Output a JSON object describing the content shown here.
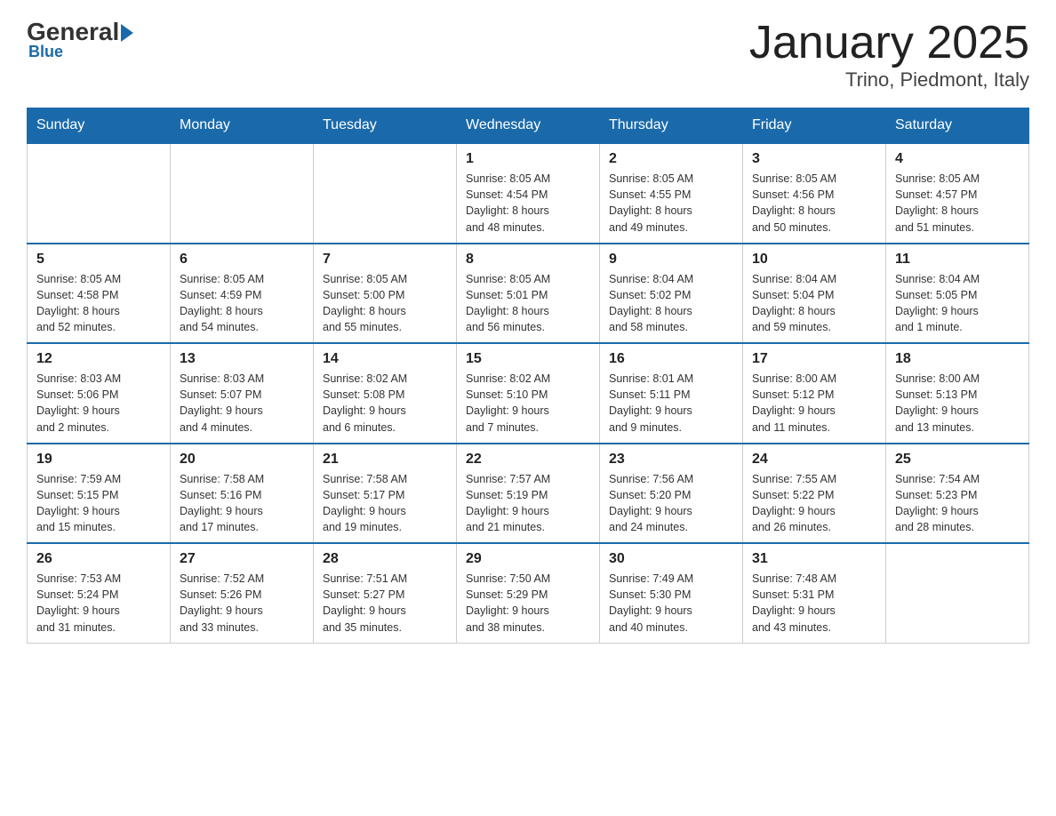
{
  "logo": {
    "general": "General",
    "blue": "Blue",
    "subtitle": "Blue"
  },
  "title": "January 2025",
  "location": "Trino, Piedmont, Italy",
  "days_of_week": [
    "Sunday",
    "Monday",
    "Tuesday",
    "Wednesday",
    "Thursday",
    "Friday",
    "Saturday"
  ],
  "weeks": [
    [
      {
        "day": "",
        "info": ""
      },
      {
        "day": "",
        "info": ""
      },
      {
        "day": "",
        "info": ""
      },
      {
        "day": "1",
        "info": "Sunrise: 8:05 AM\nSunset: 4:54 PM\nDaylight: 8 hours\nand 48 minutes."
      },
      {
        "day": "2",
        "info": "Sunrise: 8:05 AM\nSunset: 4:55 PM\nDaylight: 8 hours\nand 49 minutes."
      },
      {
        "day": "3",
        "info": "Sunrise: 8:05 AM\nSunset: 4:56 PM\nDaylight: 8 hours\nand 50 minutes."
      },
      {
        "day": "4",
        "info": "Sunrise: 8:05 AM\nSunset: 4:57 PM\nDaylight: 8 hours\nand 51 minutes."
      }
    ],
    [
      {
        "day": "5",
        "info": "Sunrise: 8:05 AM\nSunset: 4:58 PM\nDaylight: 8 hours\nand 52 minutes."
      },
      {
        "day": "6",
        "info": "Sunrise: 8:05 AM\nSunset: 4:59 PM\nDaylight: 8 hours\nand 54 minutes."
      },
      {
        "day": "7",
        "info": "Sunrise: 8:05 AM\nSunset: 5:00 PM\nDaylight: 8 hours\nand 55 minutes."
      },
      {
        "day": "8",
        "info": "Sunrise: 8:05 AM\nSunset: 5:01 PM\nDaylight: 8 hours\nand 56 minutes."
      },
      {
        "day": "9",
        "info": "Sunrise: 8:04 AM\nSunset: 5:02 PM\nDaylight: 8 hours\nand 58 minutes."
      },
      {
        "day": "10",
        "info": "Sunrise: 8:04 AM\nSunset: 5:04 PM\nDaylight: 8 hours\nand 59 minutes."
      },
      {
        "day": "11",
        "info": "Sunrise: 8:04 AM\nSunset: 5:05 PM\nDaylight: 9 hours\nand 1 minute."
      }
    ],
    [
      {
        "day": "12",
        "info": "Sunrise: 8:03 AM\nSunset: 5:06 PM\nDaylight: 9 hours\nand 2 minutes."
      },
      {
        "day": "13",
        "info": "Sunrise: 8:03 AM\nSunset: 5:07 PM\nDaylight: 9 hours\nand 4 minutes."
      },
      {
        "day": "14",
        "info": "Sunrise: 8:02 AM\nSunset: 5:08 PM\nDaylight: 9 hours\nand 6 minutes."
      },
      {
        "day": "15",
        "info": "Sunrise: 8:02 AM\nSunset: 5:10 PM\nDaylight: 9 hours\nand 7 minutes."
      },
      {
        "day": "16",
        "info": "Sunrise: 8:01 AM\nSunset: 5:11 PM\nDaylight: 9 hours\nand 9 minutes."
      },
      {
        "day": "17",
        "info": "Sunrise: 8:00 AM\nSunset: 5:12 PM\nDaylight: 9 hours\nand 11 minutes."
      },
      {
        "day": "18",
        "info": "Sunrise: 8:00 AM\nSunset: 5:13 PM\nDaylight: 9 hours\nand 13 minutes."
      }
    ],
    [
      {
        "day": "19",
        "info": "Sunrise: 7:59 AM\nSunset: 5:15 PM\nDaylight: 9 hours\nand 15 minutes."
      },
      {
        "day": "20",
        "info": "Sunrise: 7:58 AM\nSunset: 5:16 PM\nDaylight: 9 hours\nand 17 minutes."
      },
      {
        "day": "21",
        "info": "Sunrise: 7:58 AM\nSunset: 5:17 PM\nDaylight: 9 hours\nand 19 minutes."
      },
      {
        "day": "22",
        "info": "Sunrise: 7:57 AM\nSunset: 5:19 PM\nDaylight: 9 hours\nand 21 minutes."
      },
      {
        "day": "23",
        "info": "Sunrise: 7:56 AM\nSunset: 5:20 PM\nDaylight: 9 hours\nand 24 minutes."
      },
      {
        "day": "24",
        "info": "Sunrise: 7:55 AM\nSunset: 5:22 PM\nDaylight: 9 hours\nand 26 minutes."
      },
      {
        "day": "25",
        "info": "Sunrise: 7:54 AM\nSunset: 5:23 PM\nDaylight: 9 hours\nand 28 minutes."
      }
    ],
    [
      {
        "day": "26",
        "info": "Sunrise: 7:53 AM\nSunset: 5:24 PM\nDaylight: 9 hours\nand 31 minutes."
      },
      {
        "day": "27",
        "info": "Sunrise: 7:52 AM\nSunset: 5:26 PM\nDaylight: 9 hours\nand 33 minutes."
      },
      {
        "day": "28",
        "info": "Sunrise: 7:51 AM\nSunset: 5:27 PM\nDaylight: 9 hours\nand 35 minutes."
      },
      {
        "day": "29",
        "info": "Sunrise: 7:50 AM\nSunset: 5:29 PM\nDaylight: 9 hours\nand 38 minutes."
      },
      {
        "day": "30",
        "info": "Sunrise: 7:49 AM\nSunset: 5:30 PM\nDaylight: 9 hours\nand 40 minutes."
      },
      {
        "day": "31",
        "info": "Sunrise: 7:48 AM\nSunset: 5:31 PM\nDaylight: 9 hours\nand 43 minutes."
      },
      {
        "day": "",
        "info": ""
      }
    ]
  ]
}
